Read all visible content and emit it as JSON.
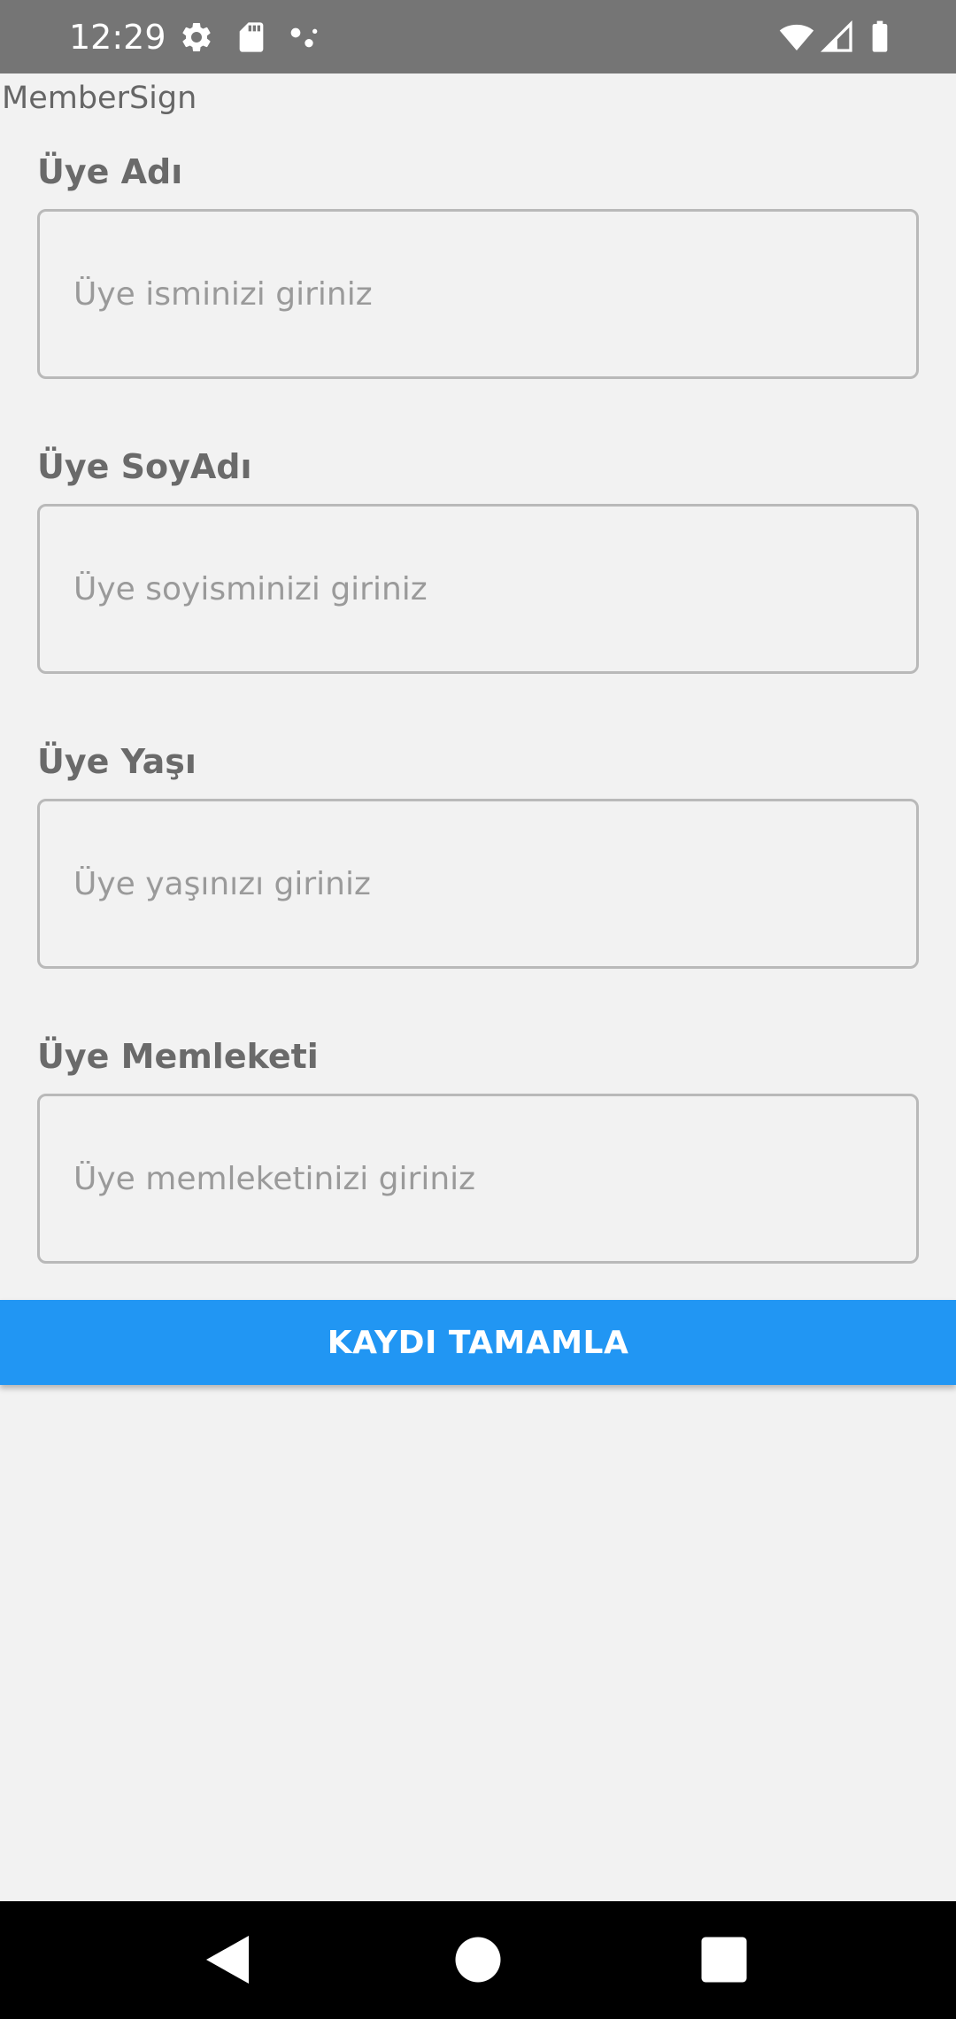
{
  "status_bar": {
    "time": "12:29",
    "icons_left": [
      "gear-icon",
      "sd-card-icon",
      "dots-icon"
    ],
    "icons_right": [
      "wifi-icon",
      "cell-signal-icon",
      "battery-icon"
    ]
  },
  "app": {
    "label": "MemberSign"
  },
  "form": {
    "fields": [
      {
        "label": "Üye Adı",
        "placeholder": "Üye isminizi giriniz"
      },
      {
        "label": "Üye SoyAdı",
        "placeholder": "Üye soyisminizi giriniz"
      },
      {
        "label": "Üye Yaşı",
        "placeholder": "Üye yaşınızı giriniz"
      },
      {
        "label": "Üye Memleketi",
        "placeholder": "Üye memleketinizi giriniz"
      }
    ],
    "submit_label": "KAYDI TAMAMLA"
  },
  "colors": {
    "status_bar": "#757575",
    "background": "#f2f2f2",
    "button": "#2196f3",
    "nav_bar": "#000000"
  },
  "nav_bar": {
    "icons": [
      "back-icon",
      "home-icon",
      "recents-icon"
    ]
  }
}
